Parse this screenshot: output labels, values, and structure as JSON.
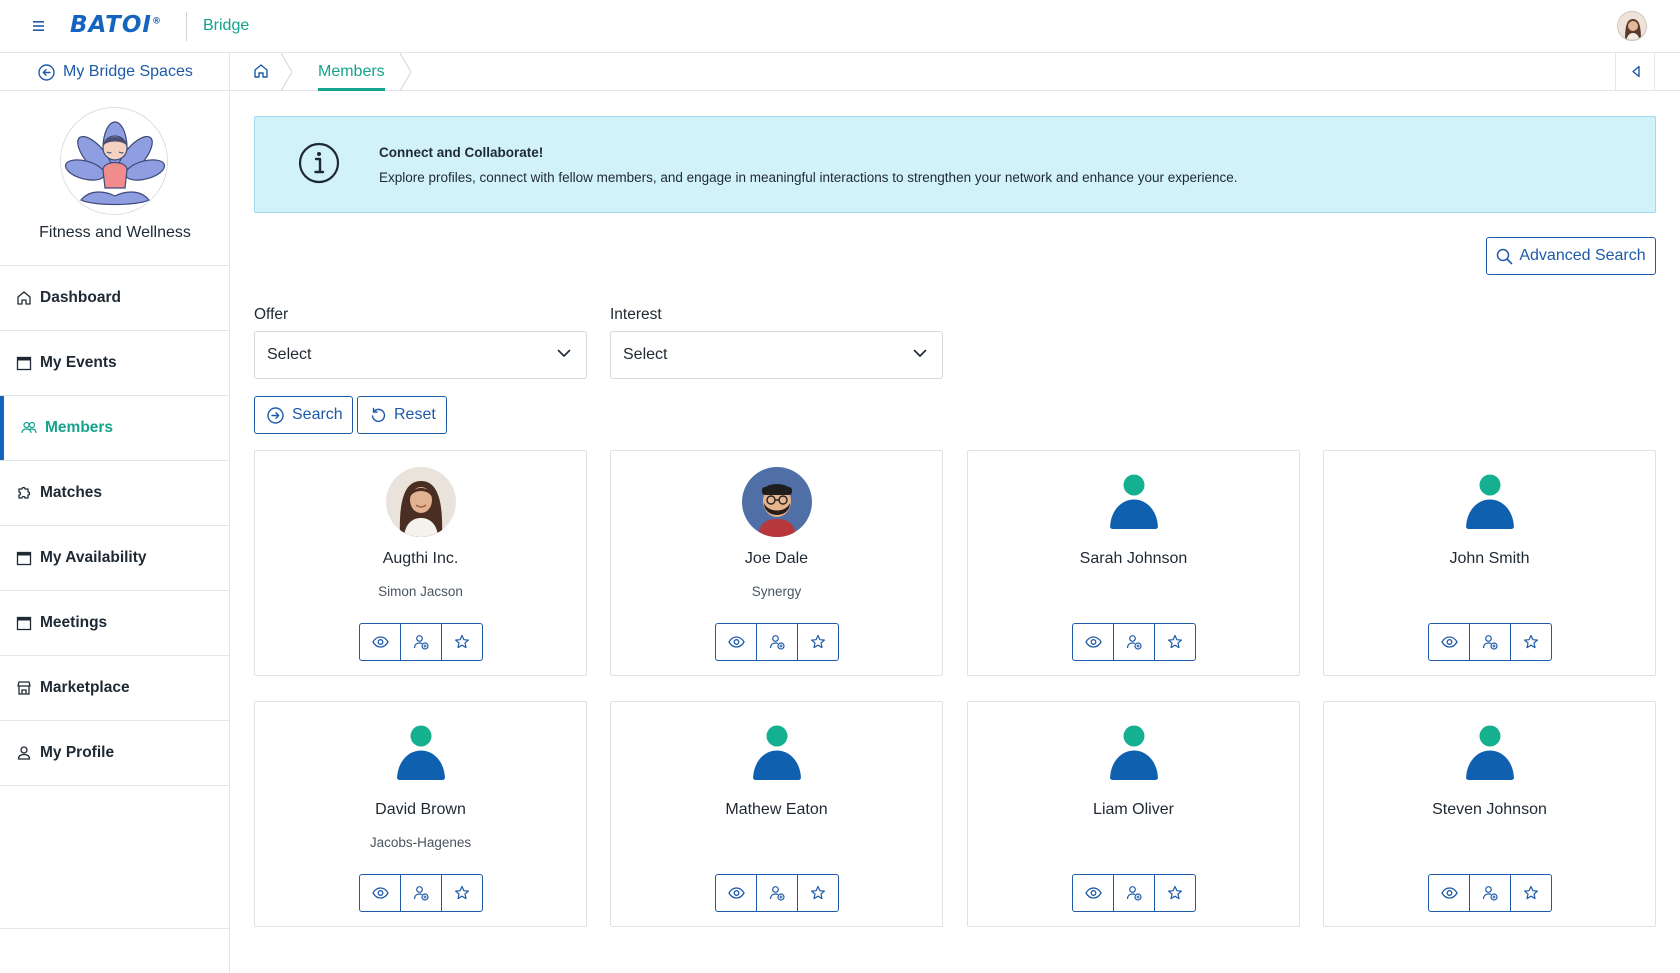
{
  "app": {
    "logo_text": "BATOI",
    "logo_mark": "®",
    "name": "Bridge",
    "colors": {
      "teal": "#14a38b",
      "blue": "#1565c0",
      "link_blue": "#1e5aa8",
      "banner_bg": "#d2f2fa"
    }
  },
  "header": {
    "hamburger_icon": "hamburger-icon",
    "user_avatar_icon": "user-avatar"
  },
  "breadcrumb": {
    "back_label": "My Bridge Spaces",
    "home_icon": "home-icon",
    "current": "Members"
  },
  "sidebar": {
    "space_name": "Fitness and Wellness",
    "items": [
      {
        "label": "Dashboard",
        "icon": "home-icon"
      },
      {
        "label": "My Events",
        "icon": "calendar-icon"
      },
      {
        "label": "Members",
        "icon": "users-icon",
        "active": true
      },
      {
        "label": "Matches",
        "icon": "puzzle-icon"
      },
      {
        "label": "My Availability",
        "icon": "calendar-icon"
      },
      {
        "label": "Meetings",
        "icon": "calendar-icon"
      },
      {
        "label": "Marketplace",
        "icon": "store-icon"
      },
      {
        "label": "My Profile",
        "icon": "person-icon"
      }
    ]
  },
  "banner": {
    "title": "Connect and Collaborate!",
    "text": "Explore profiles, connect with fellow members, and engage in meaningful interactions to strengthen your network and enhance your experience."
  },
  "filters": {
    "advanced_search_label": "Advanced Search",
    "offer": {
      "label": "Offer",
      "value": "Select"
    },
    "interest": {
      "label": "Interest",
      "value": "Select"
    },
    "search_label": "Search",
    "reset_label": "Reset"
  },
  "members": [
    {
      "name": "Augthi Inc.",
      "org": "Simon Jacson",
      "avatar": "photo-woman"
    },
    {
      "name": "Joe Dale",
      "org": "Synergy",
      "avatar": "photo-man"
    },
    {
      "name": "Sarah Johnson",
      "org": "",
      "avatar": "default"
    },
    {
      "name": "John Smith",
      "org": "",
      "avatar": "default"
    },
    {
      "name": "David Brown",
      "org": "Jacobs-Hagenes",
      "avatar": "default"
    },
    {
      "name": "Mathew Eaton",
      "org": "",
      "avatar": "default"
    },
    {
      "name": "Liam Oliver",
      "org": "",
      "avatar": "default"
    },
    {
      "name": "Steven Johnson",
      "org": "",
      "avatar": "default"
    }
  ]
}
